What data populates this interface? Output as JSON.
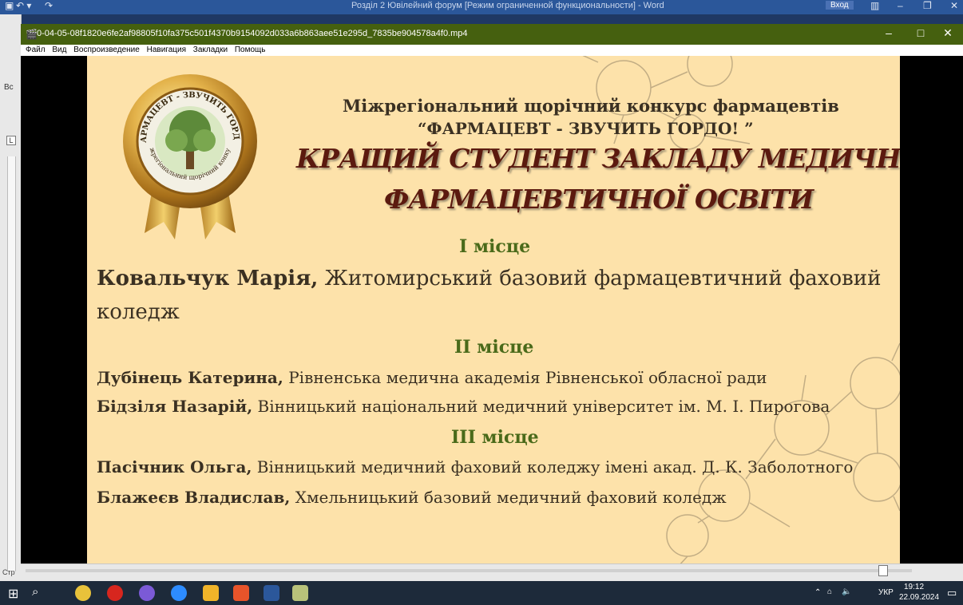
{
  "word": {
    "title": "Розділ 2 Ювілейний форум [Режим ограниченной функциональности] - Word",
    "login_button": "Вход",
    "side_label": "Вс",
    "status_left": "Стр"
  },
  "player": {
    "title": "0-04-05-08f1820e6fe2af98805f10fa375c501f4370b9154092d033a6b863aee51e295d_7835be904578a4f0.mp4",
    "menu": [
      "Файл",
      "Вид",
      "Воспроизведение",
      "Навигация",
      "Закладки",
      "Помощь"
    ]
  },
  "slide": {
    "seal_text_top": "ФАРМАЦЕВТ - ЗВУЧИТЬ ГОРДО!",
    "seal_text_bottom": "міжрегіональний щорічний конкурс",
    "heading_line1": "Міжрегіональний щорічний  конкурс фармацевтів",
    "heading_line2": "“ФАРМАЦЕВТ - ЗВУЧИТЬ ГОРДО! ”",
    "title_line1": "КРАЩИЙ СТУДЕНТ ЗАКЛАДУ МЕДИЧНОЇ /",
    "title_line2": "ФАРМАЦЕВТИЧНОЇ ОСВІТИ",
    "place1": "І місце",
    "winner1_name": "Ковальчук Марія,",
    "winner1_org_a": " Житомирський базовий фармацевтичний фаховий",
    "winner1_org_b": "коледж",
    "place2": "ІІ місце",
    "winner2_name": "Дубінець Катерина,",
    "winner2_org": " Рівненська медична академія Рівненської обласної ради",
    "winner3_name": "Бідзіля Назарій,",
    "winner3_org": " Вінницький національний медичний університет ім. М. І. Пирогова",
    "place3": "ІІІ місце",
    "winner4_name": "Пасічник Ольга,",
    "winner4_org": " Вінницький медичний фаховий коледжу імені акад. Д. К. Заболотного",
    "winner5_name": "Блажеєв Владислав,",
    "winner5_org": " Хмельницький базовий медичний фаховий коледж"
  },
  "taskbar": {
    "lang": "УКР",
    "time": "19:12",
    "date": "22.09.2024"
  }
}
